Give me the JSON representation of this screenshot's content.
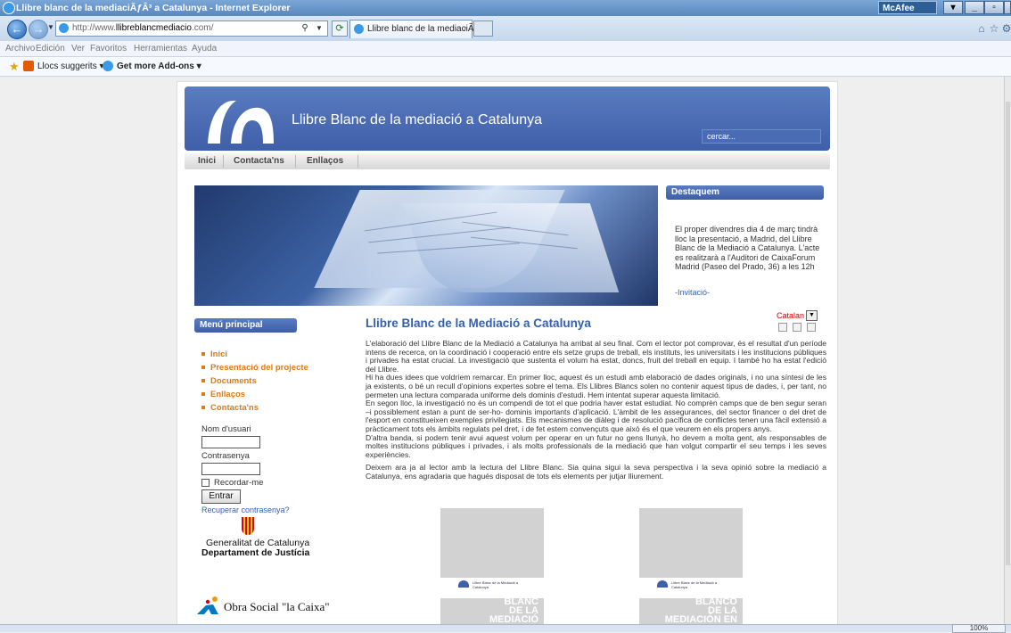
{
  "window": {
    "title": "Llibre blanc de la mediaciÃƒÂ³ a Catalunya - Internet Explorer",
    "mcafee": "McAfee",
    "controls": [
      "▾",
      "_",
      "▫",
      "✕"
    ]
  },
  "browser": {
    "url_prefix": "http://www.",
    "url_host": "llibreblancmediacio",
    "url_suffix": ".com/",
    "tab_title": "Llibre blanc de la mediaciÃƒÂ...",
    "tab_close": "×"
  },
  "menu": [
    "Archivo",
    "Edición",
    "Ver",
    "Favoritos",
    "Herramientas",
    "Ayuda"
  ],
  "favorites": {
    "suggested": "Llocs suggerits ▾",
    "addons": "Get more Add-ons ▾"
  },
  "site": {
    "title": "Llibre Blanc de la mediació a Catalunya",
    "search_placeholder": "cercar...",
    "nav": [
      "Inici",
      "Contacta'ns",
      "Enllaços"
    ]
  },
  "featured": {
    "heading": "Destaquem",
    "text": "El proper divendres dia 4 de març tindrà lloc la presentació, a Madrid, del Llibre Blanc de la Mediació a Catalunya. L'acte es realitzarà a l'Auditori de CaixaForum Madrid (Paseo del Prado, 36) a les 12h",
    "link": "-Invitació-"
  },
  "sidebar": {
    "heading": "Menú principal",
    "items": [
      "Inici",
      "Presentació del projecte",
      "Documents",
      "Enllaços",
      "Contacta'ns"
    ],
    "login": {
      "username_label": "Nom d'usuari",
      "password_label": "Contrasenya",
      "remember": "Recordar-me",
      "submit": "Entrar",
      "recover": "Recuperar contrasenya?"
    },
    "gencat_line1": "Generalitat de Catalunya",
    "gencat_line2": "Departament de Justícia",
    "caixa": "Obra Social \"la Caixa\""
  },
  "article": {
    "title": "Llibre Blanc de la Mediació a Catalunya",
    "language": "Catalan",
    "paragraphs": [
      "L'elaboració del Llibre Blanc de la Mediació a Catalunya ha arribat al seu final. Com el lector pot comprovar, és el resultat d'un període intens de recerca, on la coordinació i cooperació entre els setze grups de treball, els instituts, les universitats i les institucions públiques i privades ha estat crucial. La investigació que sustenta el volum ha estat, doncs, fruit del treball en equip. I també ho ha estat l'edició del Llibre.",
      "Hi ha dues idees que voldríem remarcar. En primer lloc, aquest és un estudi amb elaboració de dades originals, i no una síntesi de les ja existents, o bé un recull d'opinions expertes sobre el tema. Els Llibres Blancs solen no contenir aquest tipus de dades, i, per tant, no permeten una lectura comparada uniforme dels dominis d'estudi. Hem intentat superar aquesta limitació.",
      "En segon lloc, la investigació no és un compendi de tot el que podria haver estat estudiat. No comprèn camps que de ben segur seran –i possiblement estan a punt de ser-ho- dominis importants d'aplicació. L'àmbit de les assegurances, del sector financer o del dret de l'esport en constitueixen exemples privilegiats. Els mecanismes de diàleg i de resolució pacífica de conflictes tenen una fàcil extensió a pràcticament tots els àmbits regulats pel dret, i de fet estem convençuts que això és el que veurem en els propers anys.",
      "D'altra banda, si podem tenir avui aquest volum per operar en un futur no gens llunyà, ho devem a molta gent, als responsables de moltes institucions públiques i privades, i als molts professionals de la mediació que han volgut compartir el seu temps i les seves experiències.",
      "Deixem ara ja al lector amb la lectura del Llibre Blanc. Sia quina sigui la seva perspectiva i la seva opinió sobre la mediació a Catalunya, ens agradaria que hagués disposat de tots els elements per jutjar lliurement."
    ]
  },
  "covers": [
    {
      "mini": "Llibre Blanc de la Mediació a Catalunya",
      "big": "LLIBRE\nBLANC\nDE LA\nMEDIACIÓ"
    },
    {
      "mini": "Llibre Blanc de la Mediació a Catalunya",
      "big": "LIBRO\nBLANCO\nDE LA\nMEDIACIÓN EN"
    }
  ],
  "status": {
    "zoom": "100%"
  }
}
